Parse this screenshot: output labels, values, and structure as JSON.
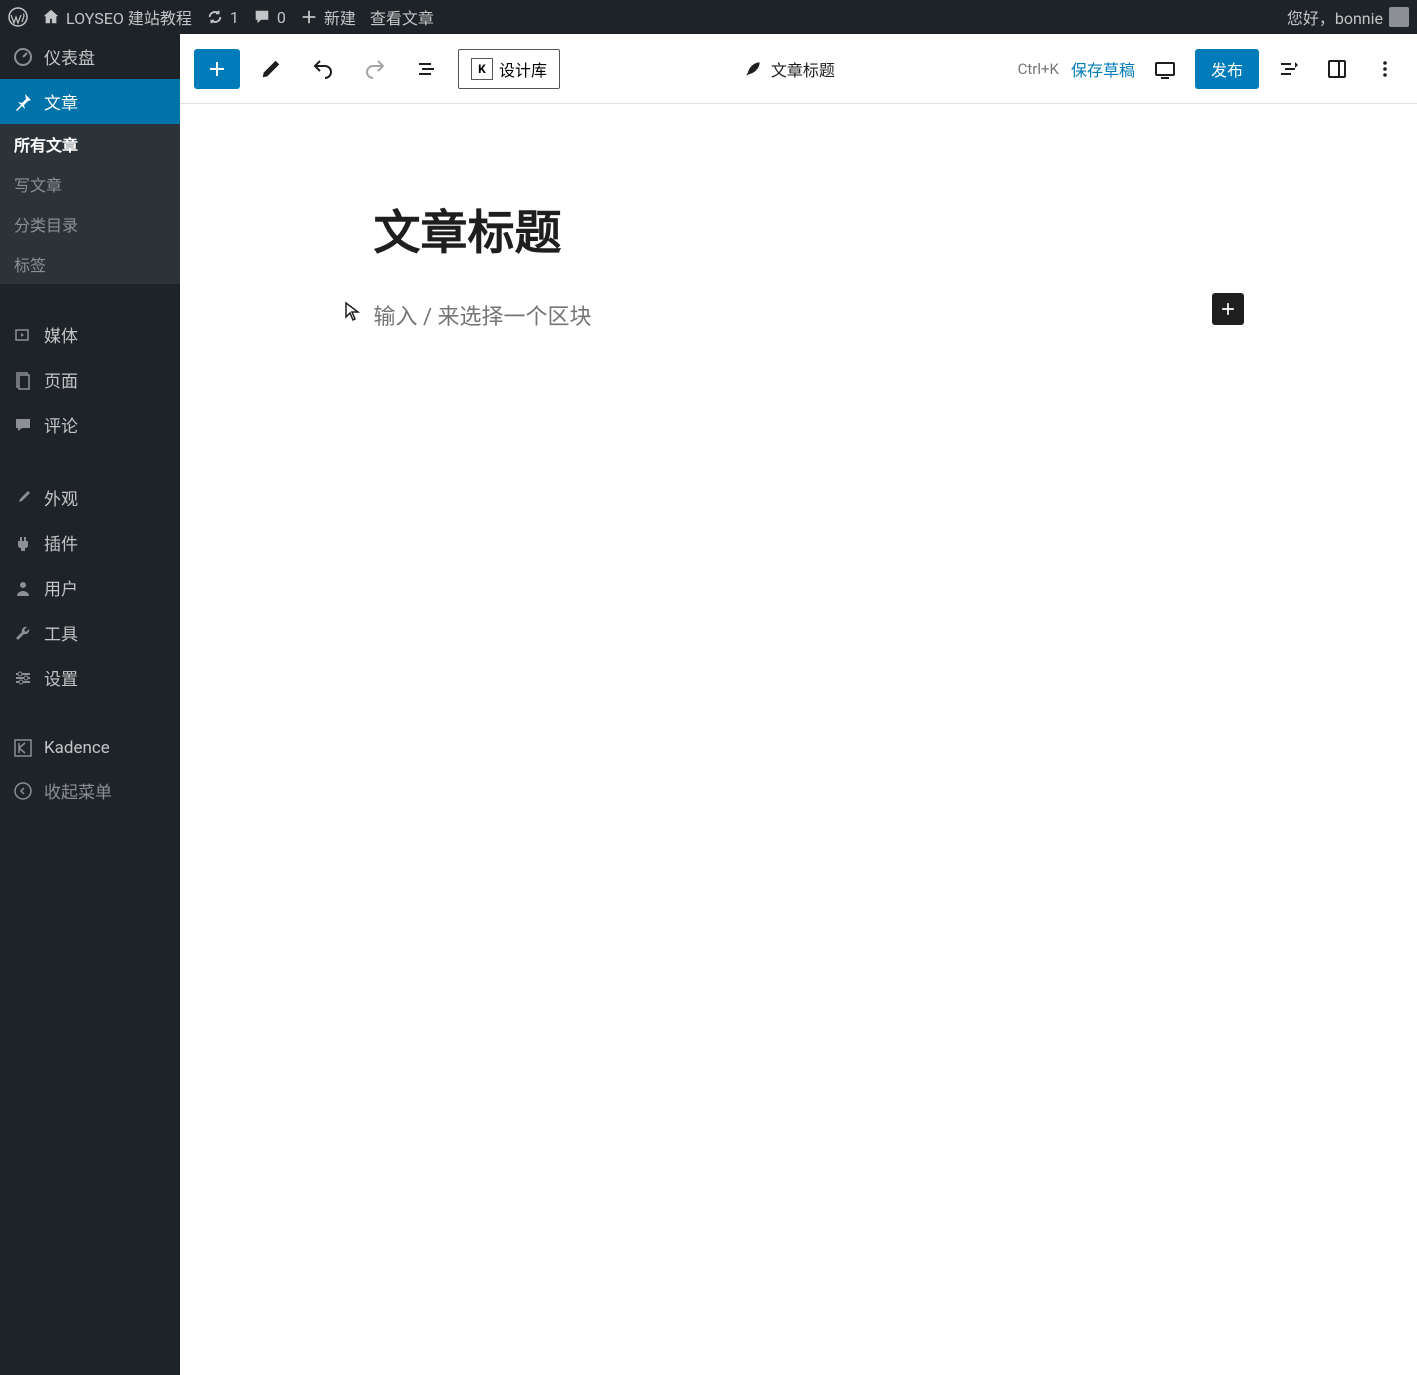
{
  "admin_bar": {
    "site_name": "LOYSEO 建站教程",
    "updates": "1",
    "comments": "0",
    "new_label": "新建",
    "view_post": "查看文章",
    "greeting": "您好，bonnie"
  },
  "sidebar": {
    "dashboard": "仪表盘",
    "posts": "文章",
    "posts_sub": {
      "all": "所有文章",
      "new": "写文章",
      "categories": "分类目录",
      "tags": "标签"
    },
    "media": "媒体",
    "pages": "页面",
    "comments": "评论",
    "appearance": "外观",
    "plugins": "插件",
    "users": "用户",
    "tools": "工具",
    "settings": "设置",
    "kadence": "Kadence",
    "collapse": "收起菜单"
  },
  "toolbar": {
    "design_library": "设计库",
    "doc_title": "文章标题",
    "shortcut": "Ctrl+K",
    "save_draft": "保存草稿",
    "publish": "发布"
  },
  "editor": {
    "title": "文章标题",
    "placeholder": "输入 / 来选择一个区块"
  }
}
